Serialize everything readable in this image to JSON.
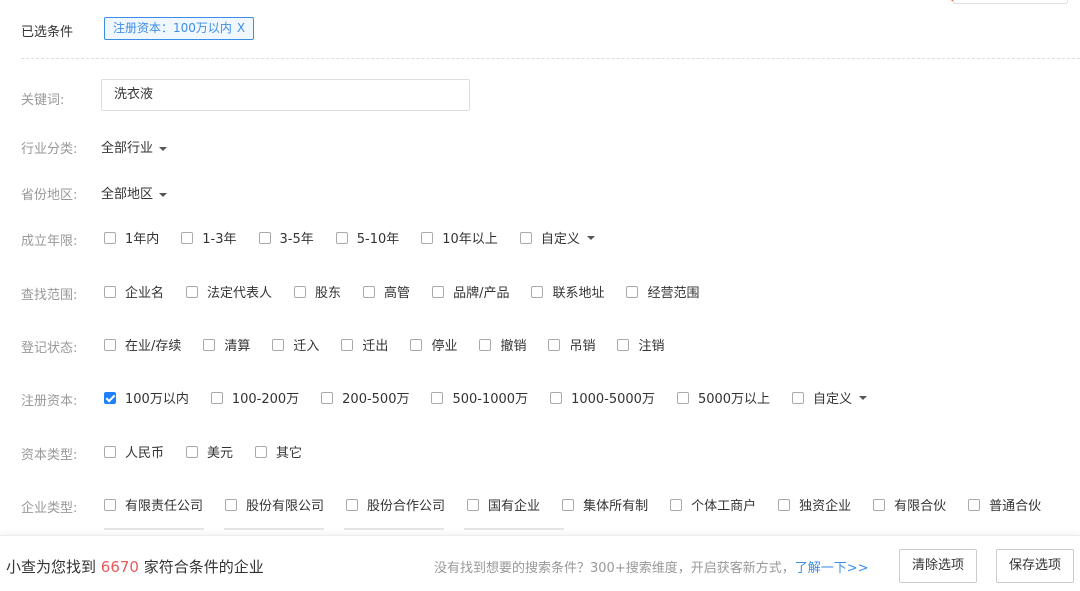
{
  "selected": {
    "label": "已选条件",
    "tag_text": "注册资本：100万以内",
    "tag_close": "X"
  },
  "keyword": {
    "label": "关键词:",
    "value": "洗衣液"
  },
  "industry": {
    "label": "行业分类:",
    "value": "全部行业"
  },
  "region": {
    "label": "省份地区:",
    "value": "全部地区"
  },
  "established": {
    "label": "成立年限:",
    "options": [
      {
        "text": "1年内",
        "checked": false
      },
      {
        "text": "1-3年",
        "checked": false
      },
      {
        "text": "3-5年",
        "checked": false
      },
      {
        "text": "5-10年",
        "checked": false
      },
      {
        "text": "10年以上",
        "checked": false
      },
      {
        "text": "自定义",
        "checked": false,
        "dropdown": true
      }
    ]
  },
  "scope": {
    "label": "查找范围:",
    "options": [
      {
        "text": "企业名",
        "checked": false
      },
      {
        "text": "法定代表人",
        "checked": false
      },
      {
        "text": "股东",
        "checked": false
      },
      {
        "text": "高管",
        "checked": false
      },
      {
        "text": "品牌/产品",
        "checked": false
      },
      {
        "text": "联系地址",
        "checked": false
      },
      {
        "text": "经营范围",
        "checked": false
      }
    ]
  },
  "status": {
    "label": "登记状态:",
    "options": [
      {
        "text": "在业/存续",
        "checked": false
      },
      {
        "text": "清算",
        "checked": false
      },
      {
        "text": "迁入",
        "checked": false
      },
      {
        "text": "迁出",
        "checked": false
      },
      {
        "text": "停业",
        "checked": false
      },
      {
        "text": "撤销",
        "checked": false
      },
      {
        "text": "吊销",
        "checked": false
      },
      {
        "text": "注销",
        "checked": false
      }
    ]
  },
  "capital": {
    "label": "注册资本:",
    "options": [
      {
        "text": "100万以内",
        "checked": true
      },
      {
        "text": "100-200万",
        "checked": false
      },
      {
        "text": "200-500万",
        "checked": false
      },
      {
        "text": "500-1000万",
        "checked": false
      },
      {
        "text": "1000-5000万",
        "checked": false
      },
      {
        "text": "5000万以上",
        "checked": false
      },
      {
        "text": "自定义",
        "checked": false,
        "dropdown": true
      }
    ]
  },
  "capital_type": {
    "label": "资本类型:",
    "options": [
      {
        "text": "人民币",
        "checked": false
      },
      {
        "text": "美元",
        "checked": false
      },
      {
        "text": "其它",
        "checked": false
      }
    ]
  },
  "company_type": {
    "label": "企业类型:",
    "options": [
      {
        "text": "有限责任公司",
        "checked": false
      },
      {
        "text": "股份有限公司",
        "checked": false
      },
      {
        "text": "股份合作公司",
        "checked": false
      },
      {
        "text": "国有企业",
        "checked": false
      },
      {
        "text": "集体所有制",
        "checked": false
      },
      {
        "text": "个体工商户",
        "checked": false
      },
      {
        "text": "独资企业",
        "checked": false
      },
      {
        "text": "有限合伙",
        "checked": false
      },
      {
        "text": "普通合伙",
        "checked": false
      }
    ]
  },
  "footer": {
    "found_prefix": "小查为您找到",
    "count": "6670",
    "found_suffix": "家符合条件的企业",
    "hint": "没有找到想要的搜索条件？300+搜索维度，开启获客新方式，",
    "hint_link": "了解一下>>",
    "clear_label": "清除选项",
    "save_label": "保存选项"
  },
  "colors": {
    "accent": "#1e80ff",
    "count": "#e95a5a",
    "tag_border": "#3b8ee8"
  }
}
